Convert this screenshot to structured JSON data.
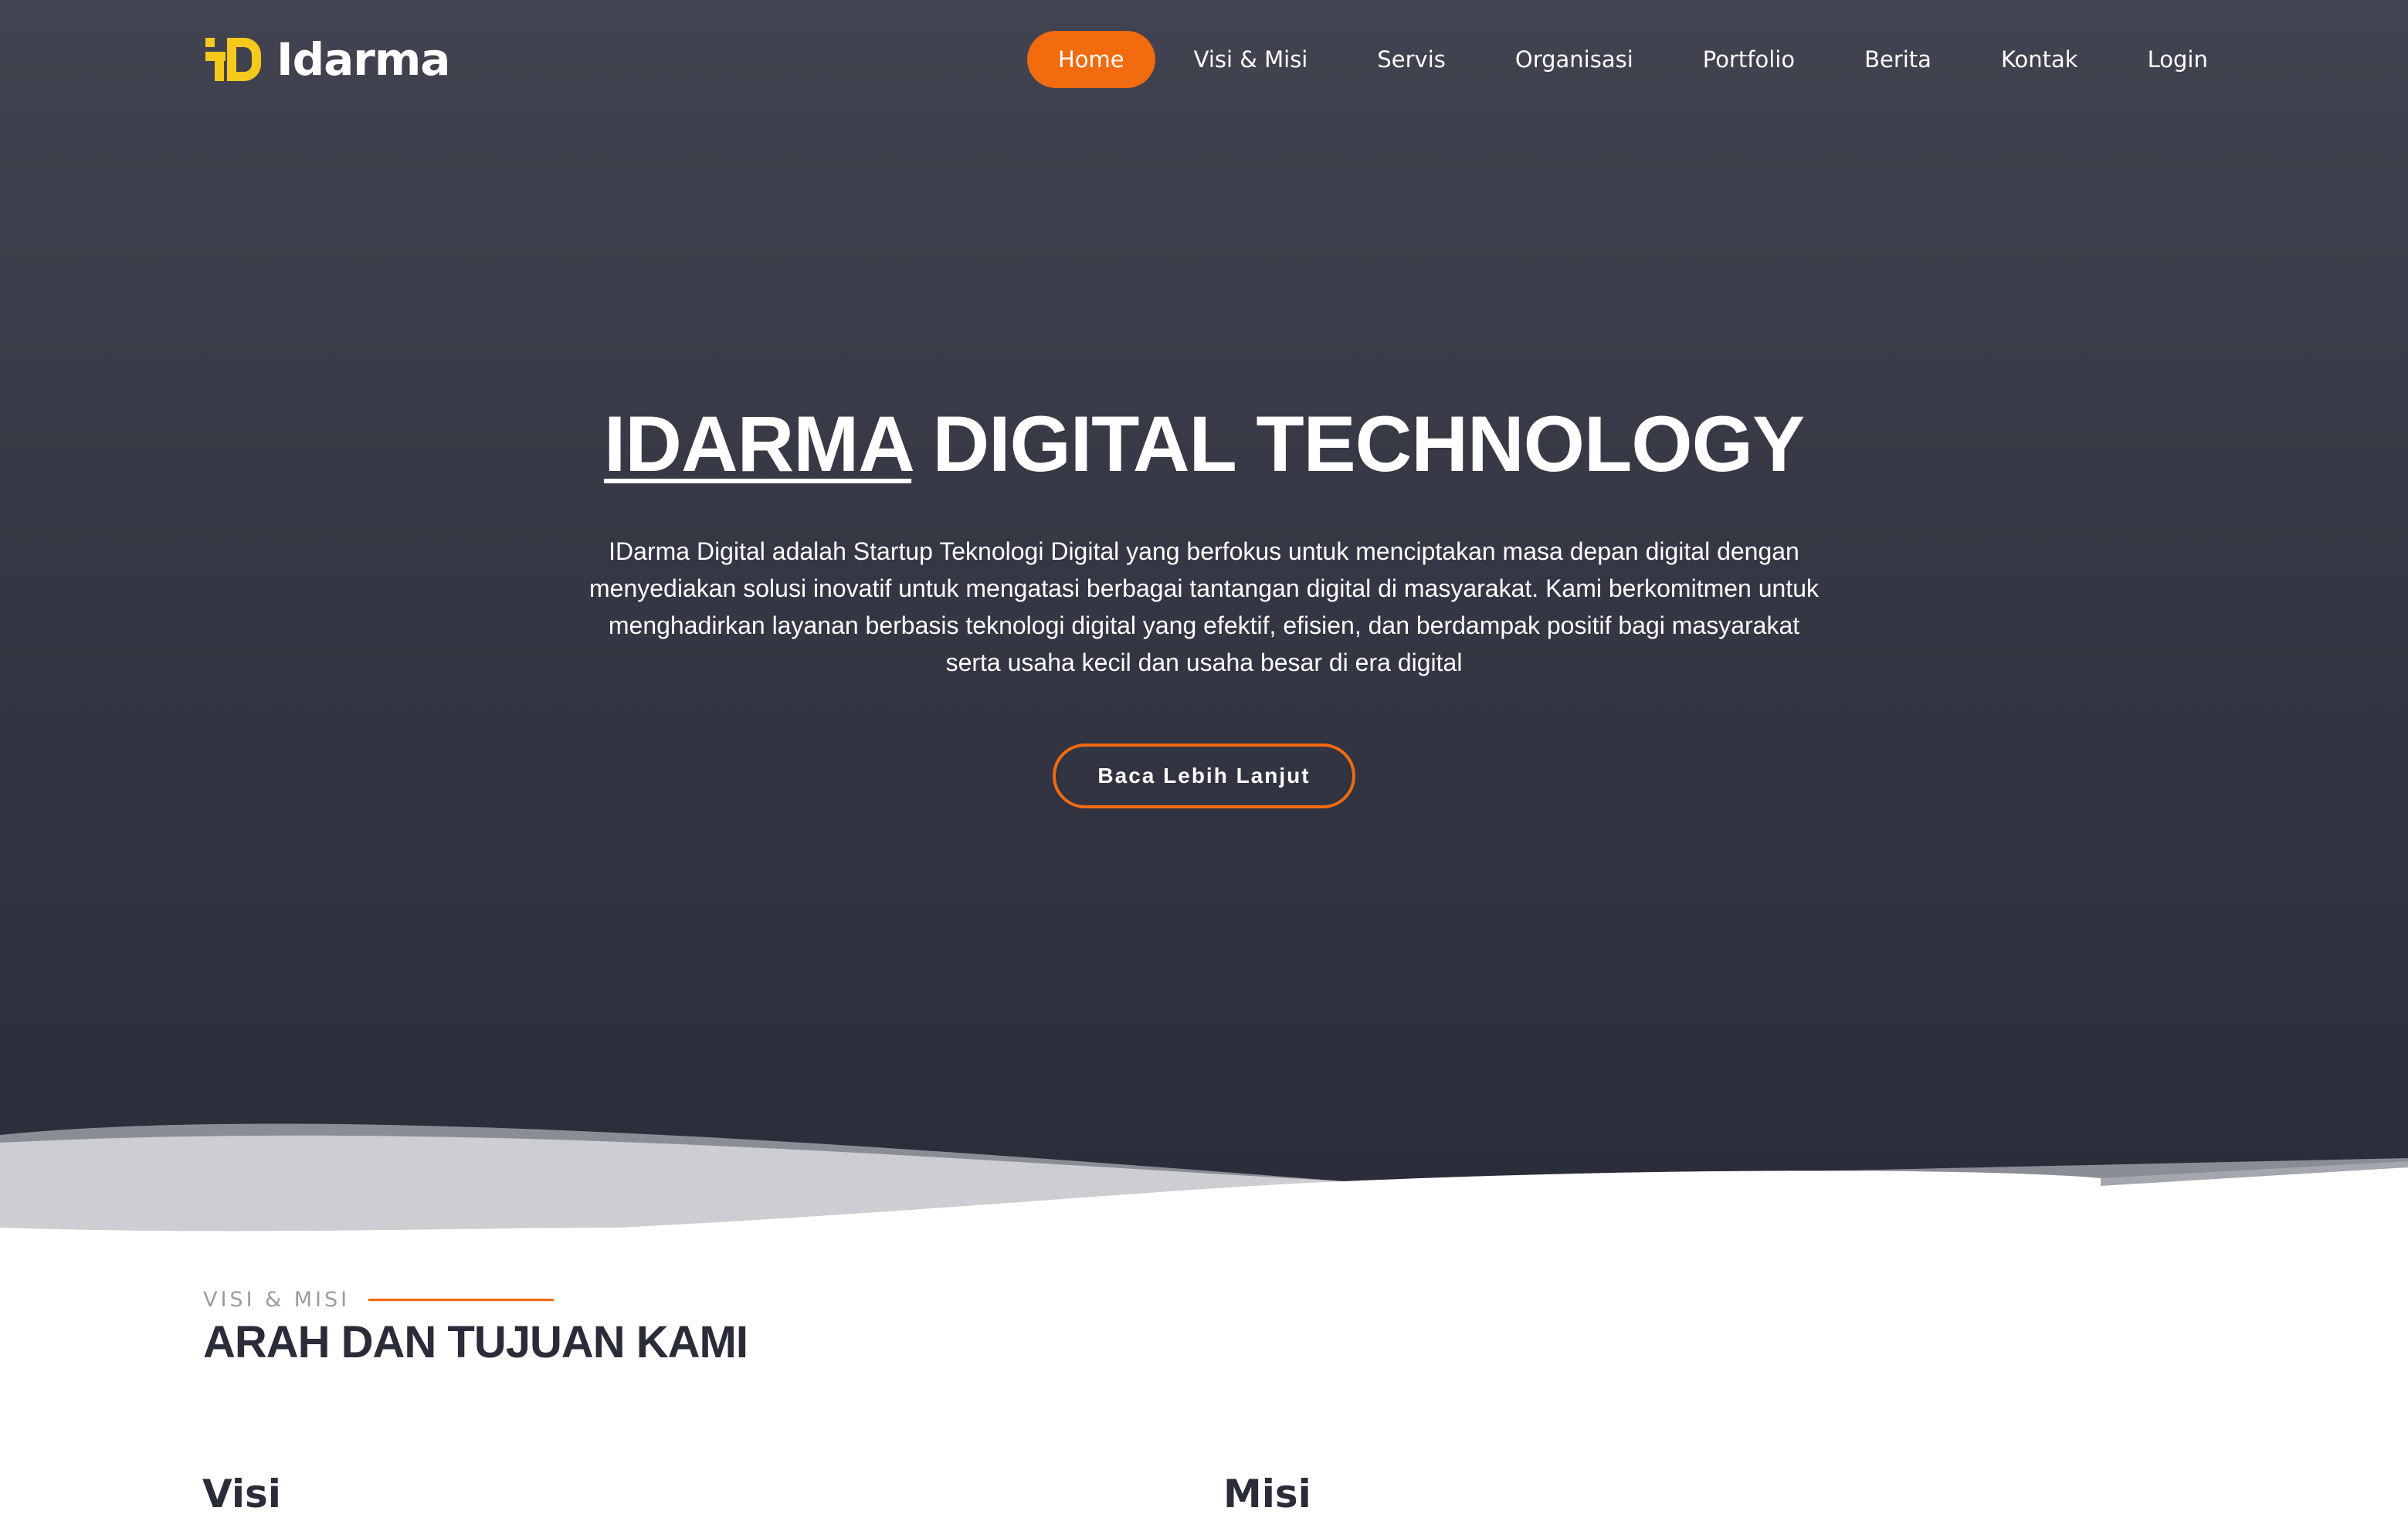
{
  "header": {
    "logo_text": "Idarma",
    "logo_icon": "idarma-logo-icon",
    "nav": [
      {
        "label": "Home",
        "active": true
      },
      {
        "label": "Visi & Misi",
        "active": false
      },
      {
        "label": "Servis",
        "active": false
      },
      {
        "label": "Organisasi",
        "active": false
      },
      {
        "label": "Portfolio",
        "active": false
      },
      {
        "label": "Berita",
        "active": false
      },
      {
        "label": "Kontak",
        "active": false
      },
      {
        "label": "Login",
        "active": false
      }
    ]
  },
  "hero": {
    "title_brand": "IDARMA",
    "title_rest": " DIGITAL TECHNOLOGY",
    "description": "IDarma Digital adalah Startup Teknologi Digital yang berfokus untuk menciptakan masa depan digital dengan menyediakan solusi inovatif untuk mengatasi berbagai tantangan digital di masyarakat. Kami berkomitmen untuk menghadirkan layanan berbasis teknologi digital yang efektif, efisien, dan berdampak positif bagi masyarakat serta usaha kecil dan usaha besar di era digital",
    "cta_label": "Baca Lebih Lanjut"
  },
  "section": {
    "label": "VISI & MISI",
    "title": "ARAH DAN TUJUAN KAMI",
    "col_left_title": "Visi",
    "col_right_title": "Misi"
  },
  "colors": {
    "accent": "#f26b0f",
    "hero_dark": "#2a2c3a",
    "logo_yellow": "#f7c91b"
  }
}
